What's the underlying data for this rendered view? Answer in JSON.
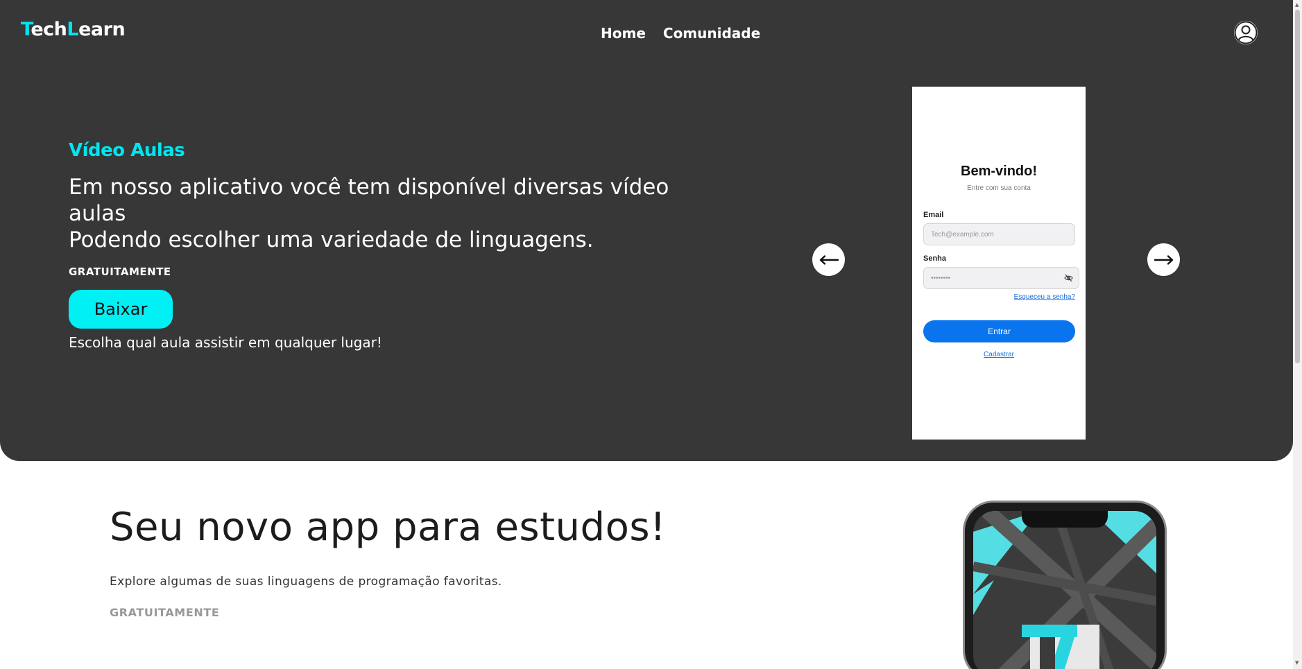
{
  "header": {
    "logo": {
      "part1_a": "T",
      "part1_b": "ech",
      "part2_a": "L",
      "part2_b": "earn"
    },
    "nav": [
      {
        "label": "Home"
      },
      {
        "label": "Comunidade"
      }
    ],
    "user_icon": "user-circle-icon"
  },
  "hero": {
    "title": "Vídeo Aulas",
    "description_line1": "Em nosso aplicativo você tem disponível diversas vídeo aulas",
    "description_line2": "Podendo escolher uma variedade de linguagens.",
    "free_label": "GRATUITAMENTE",
    "download_label": "Baixar",
    "tagline": "Escolha qual aula assistir em qualquer lugar!",
    "prev_icon": "arrow-left-icon",
    "next_icon": "arrow-right-icon"
  },
  "app_mock": {
    "title": "Bem-vindo!",
    "subtitle": "Entre com sua conta",
    "email_label": "Email",
    "email_placeholder": "Tech@example.com",
    "password_label": "Senha",
    "password_value": "••••••••",
    "forgot_label": "Esqueceu a senha?",
    "enter_label": "Entrar",
    "register_label": "Cadastrar"
  },
  "promo": {
    "title": "Seu novo app para estudos!",
    "description": "Explore algumas de suas linguagens de programação favoritas.",
    "free_label": "GRATUITAMENTE"
  },
  "colors": {
    "accent": "#00e6f0",
    "hero_bg": "#373737",
    "button_blue": "#0a74ee"
  }
}
